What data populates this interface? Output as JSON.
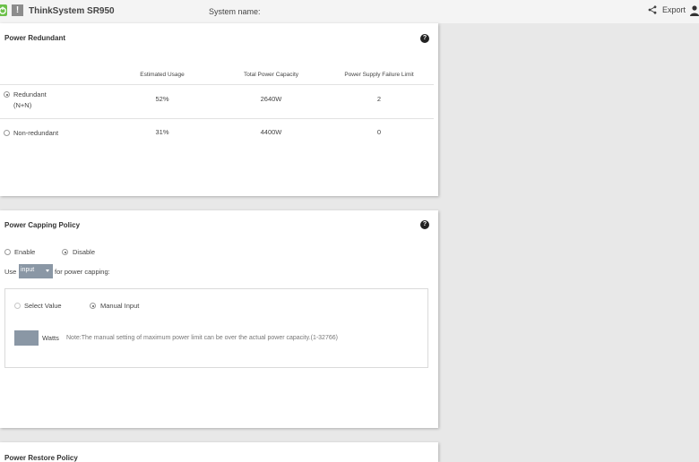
{
  "header": {
    "product": "ThinkSystem SR950",
    "system_name_label": "System name:",
    "export_label": "Export",
    "icons": [
      "power-icon",
      "warning-icon",
      "share-icon",
      "user-icon"
    ]
  },
  "power_redundant": {
    "title": "Power Redundant",
    "columns": [
      "Estimated Usage",
      "Total Power Capacity",
      "Power Supply Failure Limit"
    ],
    "rows": [
      {
        "label_line1": "Redundant",
        "label_line2": "(N+N)",
        "checked": true,
        "usage": "52%",
        "capacity": "2640W",
        "failure_limit": "2"
      },
      {
        "label_line1": "Non-redundant",
        "label_line2": "",
        "checked": false,
        "usage": "31%",
        "capacity": "4400W",
        "failure_limit": "0"
      }
    ]
  },
  "capping": {
    "title": "Power Capping Policy",
    "enable_label": "Enable",
    "disable_label": "Disable",
    "use_label": "Use",
    "select_value": "input",
    "for_label": "for power capping:",
    "select_value_option": "Select Value",
    "manual_input_option": "Manual Input",
    "watts_label": "Watts",
    "note": "Note:The manual setting of maximum power limit can be over the actual power capacity.(1-32766)"
  },
  "restore": {
    "title": "Power Restore Policy"
  },
  "help_icon_glyph": "?",
  "warning_glyph": "!"
}
